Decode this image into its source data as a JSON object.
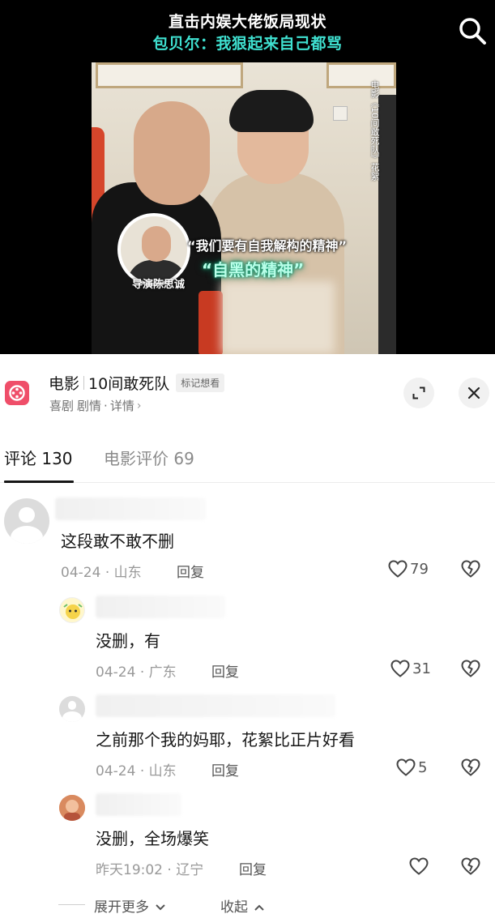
{
  "video": {
    "title_line1": "直击内娱大佬饭局现状",
    "title_line2": "包贝尔：我狠起来自己都骂",
    "side_caption": "电影《10间敢死队》花絮",
    "quote": "“我们要有自我解构的精神”",
    "glow_text": "“自黑的精神”",
    "name_caption": "导演陈思诚"
  },
  "movie": {
    "category": "电影",
    "name": "10间敢死队",
    "mark_label": "标记想看",
    "genre": "喜剧",
    "plot_label": "剧情",
    "details_label": "详情"
  },
  "tabs": [
    {
      "label": "评论 130"
    },
    {
      "label": "电影评价 69"
    }
  ],
  "comments": [
    {
      "text": "这段敢不敢不删",
      "date": "04-24",
      "location": "山东",
      "reply_label": "回复",
      "likes": "79"
    },
    {
      "text": "没删，有",
      "date": "04-24",
      "location": "广东",
      "reply_label": "回复",
      "likes": "31"
    },
    {
      "text": "之前那个我的妈耶，花絮比正片好看",
      "date": "04-24",
      "location": "山东",
      "reply_label": "回复",
      "likes": "5"
    },
    {
      "text": "没删，全场爆笑",
      "date": "昨天19:02",
      "location": "辽宁",
      "reply_label": "回复",
      "likes": ""
    }
  ],
  "footer": {
    "expand_label": "展开更多",
    "collapse_label": "收起"
  },
  "colors": {
    "accent_teal": "#3fe0d0",
    "movie_icon": "#ef4e69",
    "text_primary": "#161616",
    "text_meta": "#999999"
  },
  "icons": [
    "search-icon",
    "film-reel-icon",
    "expand-icon",
    "close-icon",
    "heart-icon",
    "broken-heart-icon",
    "chevron-right-icon",
    "chevron-down-icon",
    "chevron-up-icon"
  ]
}
